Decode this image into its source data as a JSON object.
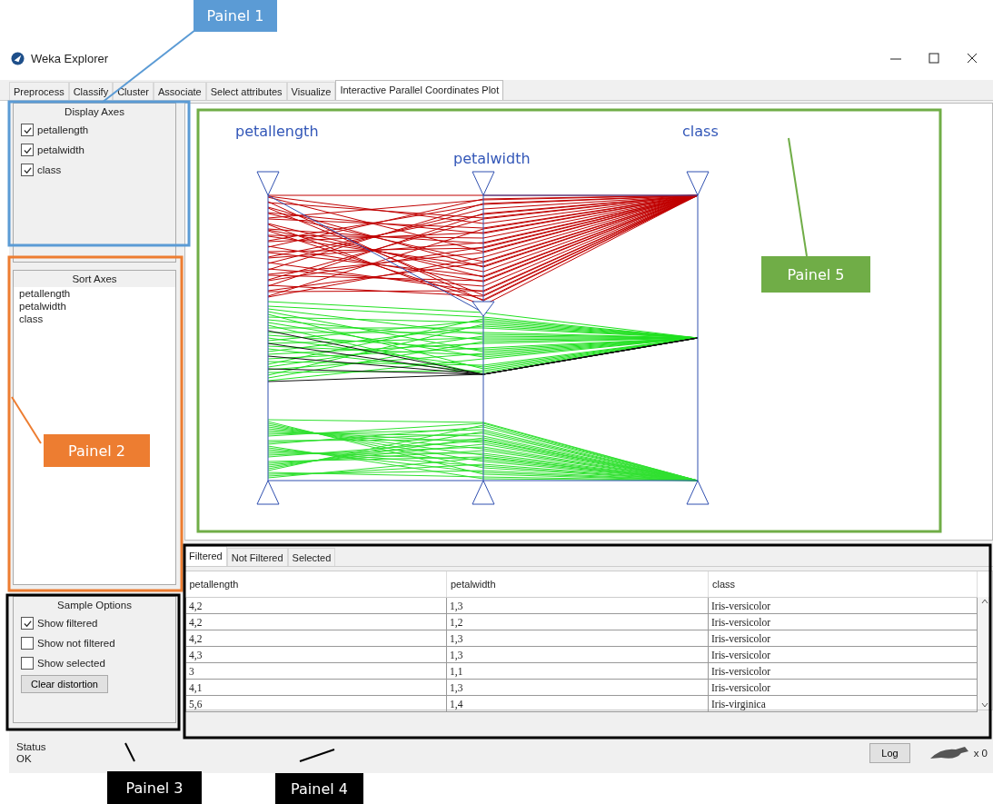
{
  "window": {
    "title": "Weka Explorer"
  },
  "tabs": [
    {
      "label": "Preprocess",
      "selected": false
    },
    {
      "label": "Classify",
      "selected": false
    },
    {
      "label": "Cluster",
      "selected": false
    },
    {
      "label": "Associate",
      "selected": false
    },
    {
      "label": "Select attributes",
      "selected": false
    },
    {
      "label": "Visualize",
      "selected": false
    },
    {
      "label": "Interactive Parallel Coordinates Plot",
      "selected": true
    }
  ],
  "display_axes": {
    "title": "Display Axes",
    "items": [
      {
        "label": "petallength",
        "checked": true
      },
      {
        "label": "petalwidth",
        "checked": true
      },
      {
        "label": "class",
        "checked": true
      }
    ]
  },
  "sort_axes": {
    "title": "Sort Axes",
    "items": [
      "petallength",
      "petalwidth",
      "class"
    ]
  },
  "sample_options": {
    "title": "Sample Options",
    "items": [
      {
        "label": "Show filtered",
        "checked": true
      },
      {
        "label": "Show not filtered",
        "checked": false
      },
      {
        "label": "Show selected",
        "checked": false
      }
    ],
    "button": "Clear distortion"
  },
  "plot": {
    "axes": [
      "petallength",
      "petalwidth",
      "class"
    ]
  },
  "table_tabs": [
    {
      "label": "Filtered",
      "selected": true
    },
    {
      "label": "Not Filtered",
      "selected": false
    },
    {
      "label": "Selected",
      "selected": false
    }
  ],
  "table": {
    "columns": [
      "petallength",
      "petalwidth",
      "class"
    ],
    "rows": [
      [
        "4,2",
        "1,3",
        "Iris-versicolor"
      ],
      [
        "4,2",
        "1,2",
        "Iris-versicolor"
      ],
      [
        "4,2",
        "1,3",
        "Iris-versicolor"
      ],
      [
        "4,3",
        "1,3",
        "Iris-versicolor"
      ],
      [
        "3",
        "1,1",
        "Iris-versicolor"
      ],
      [
        "4,1",
        "1,3",
        "Iris-versicolor"
      ],
      [
        "5,6",
        "1,4",
        "Iris-virginica"
      ]
    ]
  },
  "status": {
    "label": "Status",
    "text": "OK",
    "log_button": "Log",
    "count": "x 0"
  },
  "annotations": [
    {
      "label": "Painel 1",
      "color": "#5b9bd5"
    },
    {
      "label": "Painel 2",
      "color": "#ed7d31"
    },
    {
      "label": "Painel 3",
      "color": "#000000"
    },
    {
      "label": "Painel 4",
      "color": "#000000"
    },
    {
      "label": "Painel 5",
      "color": "#70ad47"
    }
  ]
}
